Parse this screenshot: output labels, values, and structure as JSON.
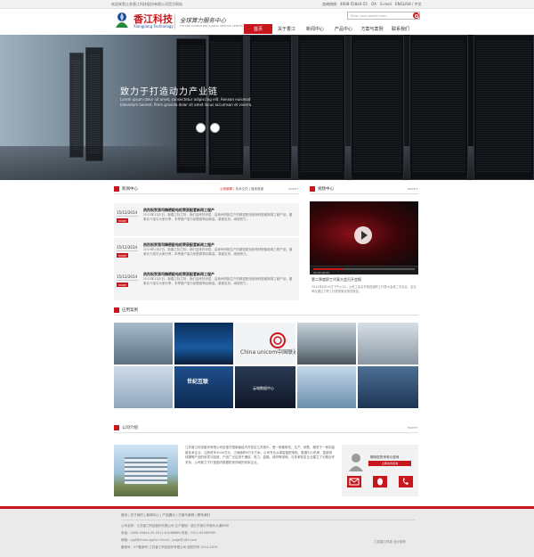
{
  "topbar": {
    "welcome": "欢迎来到江苏香江科技股份有限公司官方网站",
    "hotline": "咨询热线：4008-55844-55",
    "oa": "OA",
    "email": "E-mail",
    "lang": "ENGLISH / 中文"
  },
  "header": {
    "logo_cn": "香江科技",
    "logo_en": "Xiangjiang Technology",
    "slogan": "全球算力服务中心",
    "slogan_sub": "FUTURE COMPUTING GLOBAL SERVICE CENTER",
    "search_placeholder": "Enter your search term"
  },
  "nav": [
    {
      "label": "首页",
      "active": true
    },
    {
      "label": "关于香江",
      "active": false
    },
    {
      "label": "新闻中心",
      "active": false
    },
    {
      "label": "产品中心",
      "active": false
    },
    {
      "label": "方案与案例",
      "active": false
    },
    {
      "label": "联系我们",
      "active": false
    }
  ],
  "banner": {
    "title": "致力于打造动力产业链",
    "text": "Lorem ipsum dolor sit amet, consectetur adipiscing elit. Aenean euismod bibendum laoreet. Proin gravida dolor sit amet lacus accumsan et viverra."
  },
  "news": {
    "title": "新闻中心",
    "tabs": [
      "公司新闻",
      "技术文件",
      "媒体报道"
    ],
    "more": "more+",
    "items": [
      {
        "day": "15/12/2014",
        "month": "MORE",
        "title": "热烈祝贺我司精密配电柜荣获配套新闻工程产",
        "body": "2015年1月2日，新春之际之际，我们迎来好消息，由我司研制生产的精密配电柜荣获配套新闻工程产品，董事长介绍与大家分享，本季度产量与销售额再创新高，感谢支持，继续努力。"
      },
      {
        "day": "15/12/2014",
        "month": "MORE",
        "title": "热烈祝贺我司精密配电柜荣获配套新闻工程产",
        "body": "2015年1月2日，新春之际之际，我们迎来好消息，由我司研制生产的精密配电柜荣获配套新闻工程产品，董事长介绍与大家分享，本季度产量与销售额再创新高，感谢支持，继续努力。"
      },
      {
        "day": "15/12/2014",
        "month": "MORE",
        "title": "热烈祝贺我司精密配电柜荣获配套新闻工程产",
        "body": "2015年1月2日，新春之际之际，我们迎来好消息，由我司研制生产的精密配电柜荣获配套新闻工程产品，董事长介绍与大家分享，本季度产量与销售额再创新高，感谢支持，继续努力。"
      }
    ]
  },
  "video": {
    "title": "视频中心",
    "more": "more+",
    "time": "00:00   00:00",
    "caption": "第二季度职工代表大会召开会报",
    "desc": "2014年8月15日下午4:30，公司工会召开第四届职工代表大会第二次会议，会议审议通过了职工代表提案及相关报告。"
  },
  "gallery": {
    "title": "应用案例",
    "more": "more+",
    "labels": [
      "China unicom中国联通",
      "世纪互联",
      "云城数据中心"
    ]
  },
  "about": {
    "title": "公司介绍",
    "more": "more+",
    "text": "江苏香江科技股份有限公司坐落于国家级经济开发区江苏扬中，是一家集研发、生产、销售、服务于一体的高新技术企业，注册资本5000万元，占地面积6万平方米。公司专业从事智能配电柜、数据中心机房、智能母线槽等产品的研发与制造，产品广泛应用于通信、电力、金融、政府等领域，与多家知名企业建立了长期合作关系。公司致力于打造国内数据机房领域的领军企业。",
    "contact_title": "期待您的来电与咨询",
    "contact_btn": "立即在线咨询"
  },
  "footer": {
    "links": "首页 | 关于我们 | 新闻中心 | 产品展示 | 方案与案例 | 联系我们",
    "line1": "公司名称：江苏香江科技股份有限公司      生产基地：镇江市扬中市港东大道88号",
    "line2": "电话：4008-55844-55         0511-81068888         传真：0511-81069999",
    "line3": "邮箱：xjgf@china-xjgf.cn           Email：jsxjgf@163.com",
    "line4": "备案号：ICP备案号 江苏香江科技股份有限公司 版权所有 2014-2019",
    "right": "江苏香江科技 设计制作"
  },
  "colors": {
    "brand_red": "#c8161d"
  }
}
